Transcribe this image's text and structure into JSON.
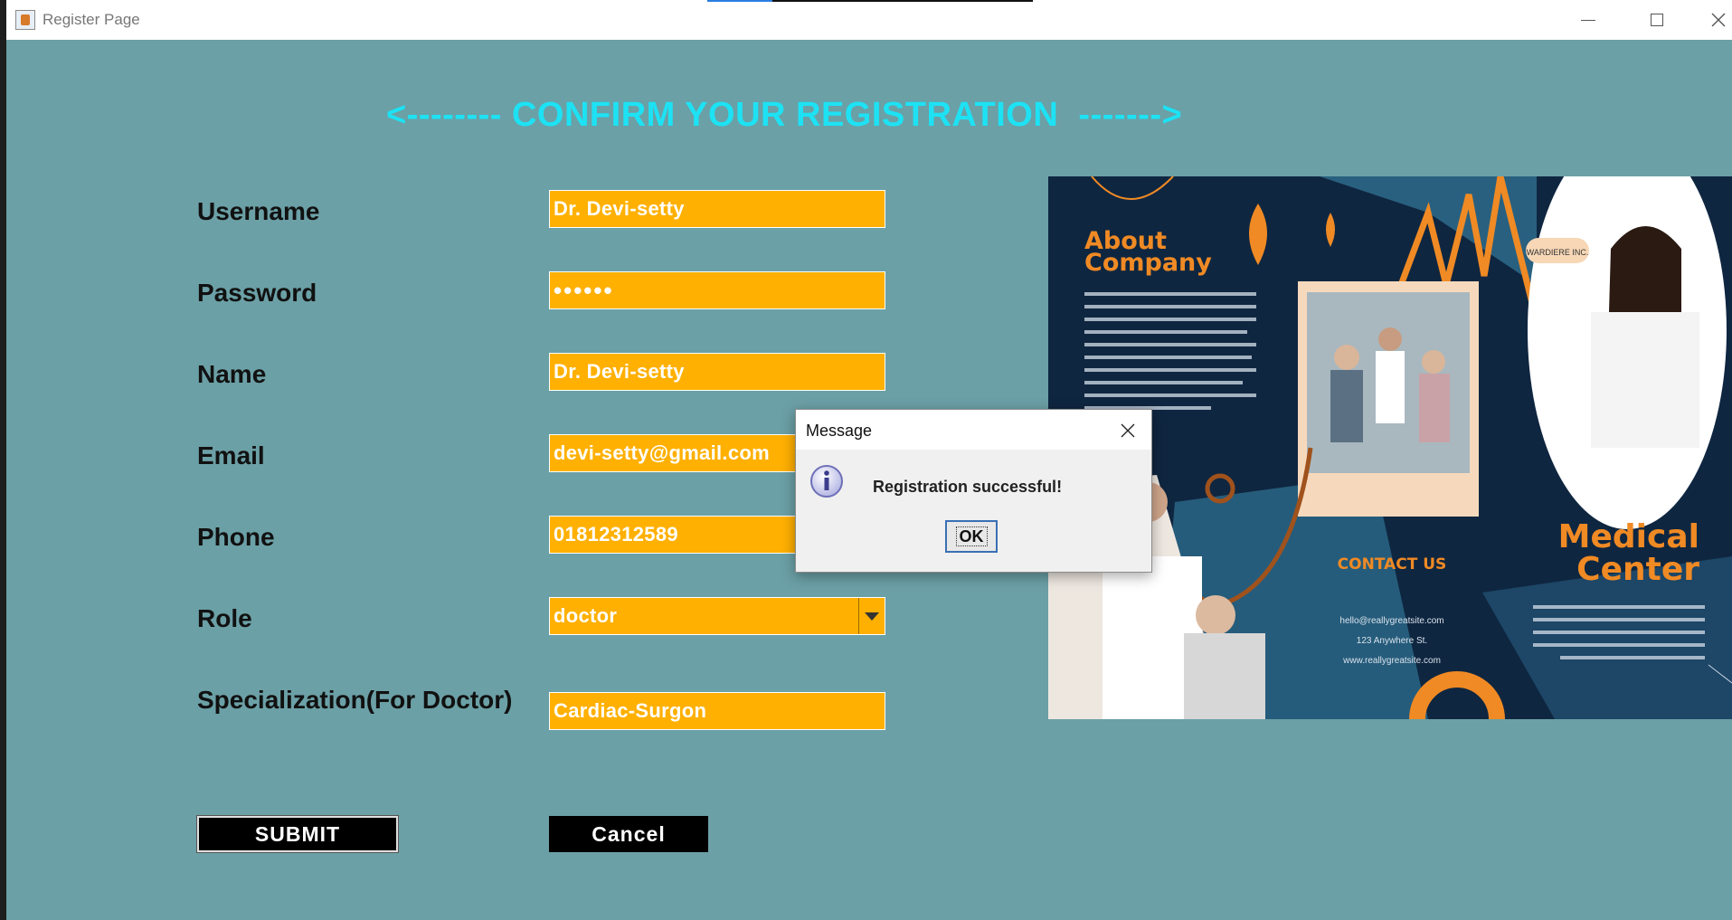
{
  "window": {
    "title": "Register Page",
    "controls": [
      "minimize",
      "maximize",
      "close"
    ]
  },
  "form": {
    "heading": "<-------- CONFIRM YOUR REGISTRATION  ------->",
    "fields": [
      {
        "label": "Username",
        "value": "Dr. Devi-setty"
      },
      {
        "label": "Password",
        "value": "••••••"
      },
      {
        "label": "Name",
        "value": "Dr. Devi-setty"
      },
      {
        "label": "Email",
        "value": "devi-setty@gmail.com"
      },
      {
        "label": "Phone",
        "value": "01812312589"
      },
      {
        "label": "Role",
        "value": "doctor"
      },
      {
        "label": "Specialization(For Doctor)",
        "value": "Cardiac-Surgon"
      }
    ],
    "submit_label": "SUBMIT",
    "cancel_label": "Cancel"
  },
  "brochure": {
    "about_title_1": "About",
    "about_title_2": "Company",
    "badge": "WARDIERE INC.",
    "contact_title": "CONTACT US",
    "contact_lines": [
      "hello@reallygreatsite.com",
      "123 Anywhere St.",
      "www.reallygreatsite.com"
    ],
    "center_title_1": "Medical",
    "center_title_2": "Center"
  },
  "dialog": {
    "title": "Message",
    "message": "Registration successful!",
    "ok_label": "OK",
    "icon": "info-icon"
  },
  "colors": {
    "background": "#6ba0a6",
    "heading": "#1de2f4",
    "field": "#ffb000",
    "brochure_navy": "#0f2640",
    "brochure_orange": "#f08a24"
  }
}
